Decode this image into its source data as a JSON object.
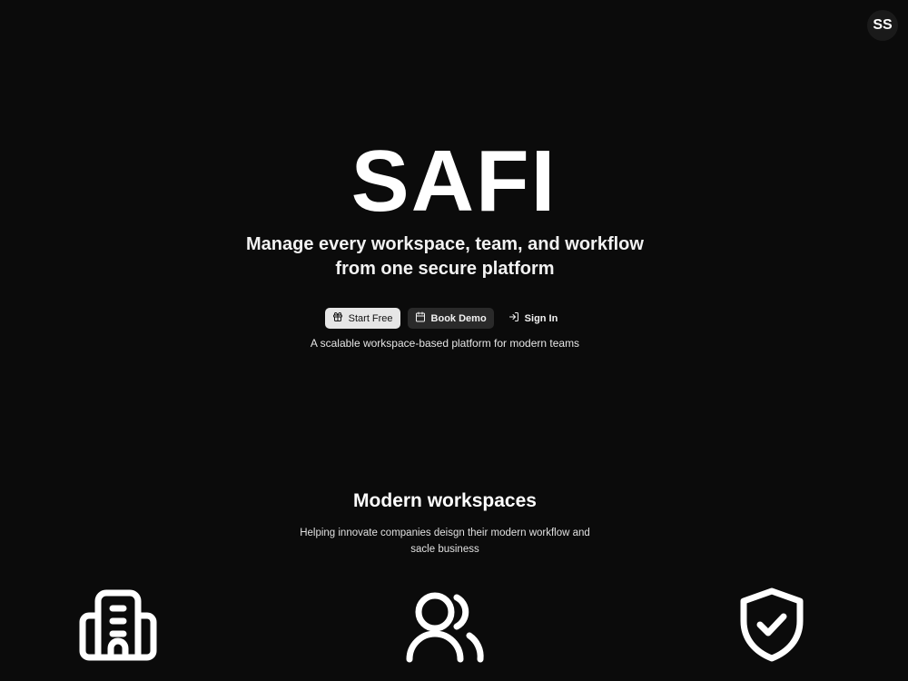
{
  "header": {
    "avatar_initials": "SS"
  },
  "hero": {
    "title": "SAFI",
    "subtitle": "Manage every workspace, team, and workflow from one secure platform",
    "tagline": "A scalable workspace-based platform for modern teams"
  },
  "actions": {
    "start_free": {
      "label": "Start Free",
      "icon": "gift-icon"
    },
    "book_demo": {
      "label": "Book Demo",
      "icon": "calendar-icon"
    },
    "sign_in": {
      "label": "Sign In",
      "icon": "sign-in-icon"
    }
  },
  "section": {
    "title": "Modern workspaces",
    "description": "Helping innovate companies deisgn their modern workflow and sacle business"
  },
  "features": [
    {
      "icon": "building-icon"
    },
    {
      "icon": "users-icon"
    },
    {
      "icon": "shield-check-icon"
    }
  ],
  "colors": {
    "background": "#0b0b0b",
    "text": "#ffffff",
    "primary_button": "#e6e6e6",
    "secondary_button": "#2a2a2a"
  }
}
